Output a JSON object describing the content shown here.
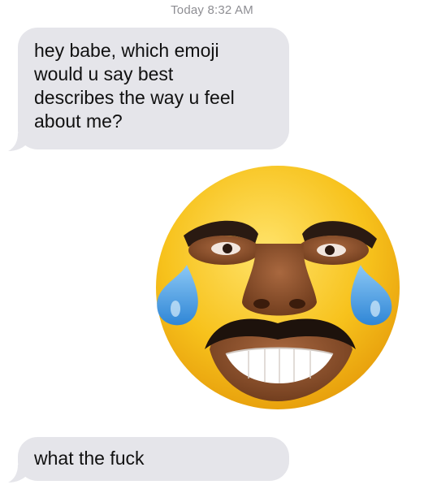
{
  "header": {
    "timestamp": "Today 8:32 AM"
  },
  "messages": [
    {
      "direction": "incoming",
      "text": "hey babe, which emoji\nwould u say best\ndescribes the way u feel\nabout me?"
    },
    {
      "direction": "incoming",
      "type": "image",
      "image_desc": "face-with-tears-of-joy-emoji-with-human-face"
    },
    {
      "direction": "incoming",
      "text": "what the fuck"
    }
  ],
  "colors": {
    "bubble_incoming": "#e5e5ea",
    "timestamp": "#8e8e93",
    "emoji_yellow": "#f7c21c",
    "tear_blue": "#4aa0e6"
  }
}
